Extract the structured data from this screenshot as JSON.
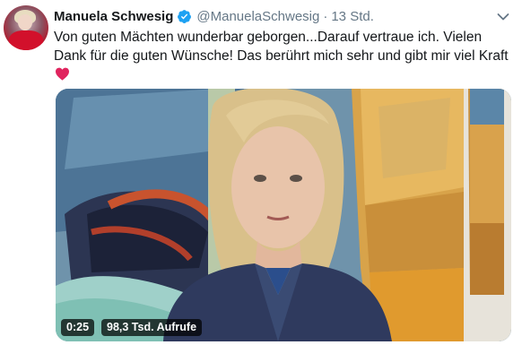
{
  "tweet": {
    "author_name": "Manuela Schwesig",
    "handle": "@ManuelaSchwesig",
    "separator": "·",
    "time": "13 Std.",
    "text": "Von guten Mächten wunderbar geborgen...Darauf vertraue ich. Vielen Dank für die guten Wünsche! Das berührt mich sehr und gibt mir viel Kraft",
    "text_emoji": "red-heart"
  },
  "video": {
    "duration": "0:25",
    "views": "98,3 Tsd. Aufrufe"
  },
  "colors": {
    "verified_blue": "#1da1f2",
    "heart_red": "#e0245e",
    "secondary_text": "#657786"
  },
  "icons": {
    "verified": "verified-badge-icon",
    "menu": "chevron-down-icon",
    "emoji": "heart-icon"
  }
}
